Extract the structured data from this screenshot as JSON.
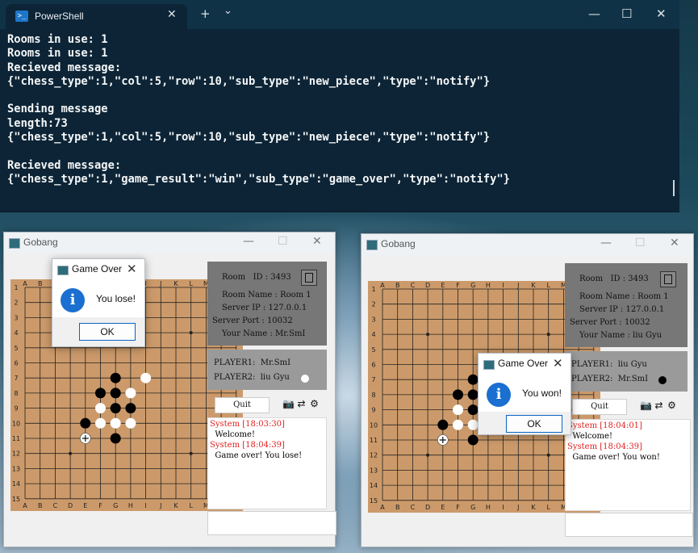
{
  "terminal": {
    "tab_title": "PowerShell",
    "tab_close": "✕",
    "new_tab": "+",
    "dropdown": "⌄",
    "minimize": "—",
    "maximize": "☐",
    "close": "✕",
    "lines": [
      "Rooms in use: 1",
      "Rooms in use: 1",
      "Recieved message:",
      "{\"chess_type\":1,\"col\":5,\"row\":10,\"sub_type\":\"new_piece\",\"type\":\"notify\"}",
      "",
      "Sending message",
      "length:73",
      "{\"chess_type\":1,\"col\":5,\"row\":10,\"sub_type\":\"new_piece\",\"type\":\"notify\"}",
      "",
      "Recieved message:",
      "{\"chess_type\":1,\"game_result\":\"win\",\"sub_type\":\"game_over\",\"type\":\"notify\"}"
    ]
  },
  "board": {
    "cols": [
      "A",
      "B",
      "C",
      "D",
      "E",
      "F",
      "G",
      "H",
      "I",
      "J",
      "K",
      "L",
      "M",
      "N",
      "O"
    ],
    "rows": [
      "1",
      "2",
      "3",
      "4",
      "5",
      "6",
      "7",
      "8",
      "9",
      "10",
      "11",
      "12",
      "13",
      "14",
      "15"
    ],
    "star_points": [
      [
        3,
        3
      ],
      [
        3,
        11
      ],
      [
        7,
        7
      ],
      [
        11,
        3
      ],
      [
        11,
        11
      ]
    ],
    "colors": {
      "wood": "#cc9a6a",
      "line": "#222222",
      "black": "#000000",
      "white": "#ffffff"
    },
    "stones": [
      {
        "col": "G",
        "row": 7,
        "color": "black"
      },
      {
        "col": "I",
        "row": 7,
        "color": "white"
      },
      {
        "col": "F",
        "row": 8,
        "color": "black"
      },
      {
        "col": "G",
        "row": 8,
        "color": "black"
      },
      {
        "col": "H",
        "row": 8,
        "color": "white"
      },
      {
        "col": "F",
        "row": 9,
        "color": "white"
      },
      {
        "col": "G",
        "row": 9,
        "color": "black"
      },
      {
        "col": "H",
        "row": 9,
        "color": "black"
      },
      {
        "col": "E",
        "row": 10,
        "color": "black"
      },
      {
        "col": "F",
        "row": 10,
        "color": "white"
      },
      {
        "col": "G",
        "row": 10,
        "color": "white"
      },
      {
        "col": "H",
        "row": 10,
        "color": "white"
      },
      {
        "col": "G",
        "row": 11,
        "color": "black"
      }
    ],
    "last_move": {
      "col": "E",
      "row": 11
    }
  },
  "windows": [
    {
      "title": "Gobang",
      "minimize": "—",
      "maximize": "☐",
      "close": "✕",
      "room": {
        "room_id_label": "Room   ID : 3493",
        "room_name": "Room Name : Room 1",
        "server_ip": "Server IP : 127.0.0.1",
        "server_port": "Server Port : 10032",
        "your_name": "Your Name : Mr.SmI"
      },
      "player1": "PLAYER1:  Mr.SmI",
      "player2": "PLAYER2:  liu Gyu",
      "player2_stone": "white",
      "quit_label": "Quit",
      "log": [
        {
          "text": "System [18:03:30]",
          "sys": true
        },
        {
          "text": "  Welcome!",
          "sys": false
        },
        {
          "text": "System [18:04:39]",
          "sys": true
        },
        {
          "text": "  Game over! You lose!",
          "sys": false
        }
      ],
      "dialog": {
        "title": "Game Over",
        "message": "You lose!",
        "ok": "OK",
        "close": "✕",
        "icon": "i"
      }
    },
    {
      "title": "Gobang",
      "minimize": "—",
      "maximize": "☐",
      "close": "✕",
      "room": {
        "room_id_label": "Room   ID : 3493",
        "room_name": "Room Name : Room 1",
        "server_ip": "Server IP : 127.0.0.1",
        "server_port": "Server Port : 10032",
        "your_name": "Your Name : liu Gyu"
      },
      "player1": "PLAYER1:  liu Gyu",
      "player2": "PLAYER2:  Mr.SmI",
      "player2_stone": "black",
      "quit_label": "Quit",
      "log": [
        {
          "text": "System [18:04:01]",
          "sys": true
        },
        {
          "text": "  Welcome!",
          "sys": false
        },
        {
          "text": "System [18:04:39]",
          "sys": true
        },
        {
          "text": "  Game over! You won!",
          "sys": false
        }
      ],
      "dialog": {
        "title": "Game Over",
        "message": "You won!",
        "ok": "OK",
        "close": "✕",
        "icon": "i"
      }
    }
  ]
}
